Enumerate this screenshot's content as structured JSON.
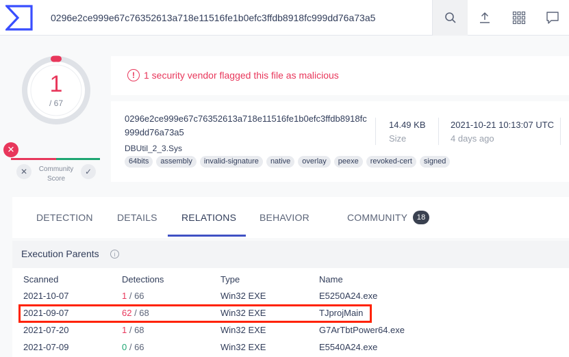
{
  "search": {
    "value": "0296e2ce999e67c76352613a718e11516fe1b0efc3ffdb8918fc999dd76a73a5"
  },
  "toolbar": {
    "icons": [
      "search-icon",
      "upload-icon",
      "apps-grid-icon",
      "chat-icon"
    ]
  },
  "score": {
    "detections": "1",
    "total": "/ 67",
    "community_label_line1": "Community",
    "community_label_line2": "Score"
  },
  "alert": {
    "text": "1 security vendor flagged this file as malicious",
    "icon": "!"
  },
  "file": {
    "hash_line1": "0296e2ce999e67c76352613a718e11516fe1b0efc3ffdb8918fc",
    "hash_line2": "999dd76a73a5",
    "name": "DBUtil_2_3.Sys",
    "tags": [
      "64bits",
      "assembly",
      "invalid-signature",
      "native",
      "overlay",
      "peexe",
      "revoked-cert",
      "signed"
    ],
    "size_value": "14.49 KB",
    "size_label": "Size",
    "date_value": "2021-10-21 10:13:07 UTC",
    "date_label": "4 days ago"
  },
  "tabs": [
    {
      "label": "DETECTION"
    },
    {
      "label": "DETAILS"
    },
    {
      "label": "RELATIONS",
      "active": true
    },
    {
      "label": "BEHAVIOR"
    },
    {
      "label": "COMMUNITY",
      "badge": "18"
    }
  ],
  "relations": {
    "section_title": "Execution Parents",
    "columns": [
      "Scanned",
      "Detections",
      "Type",
      "Name"
    ],
    "rows": [
      {
        "scanned": "2021-10-07",
        "det_pos": "1",
        "det_total": " / 66",
        "type": "Win32 EXE",
        "name": "E5250A24.exe",
        "color": "red"
      },
      {
        "scanned": "2021-09-07",
        "det_pos": "62",
        "det_total": " / 68",
        "type": "Win32 EXE",
        "name": "TJprojMain",
        "color": "red",
        "highlighted": true
      },
      {
        "scanned": "2021-07-20",
        "det_pos": "1",
        "det_total": " / 68",
        "type": "Win32 EXE",
        "name": "G7ArTbtPower64.exe",
        "color": "red"
      },
      {
        "scanned": "2021-07-09",
        "det_pos": "0",
        "det_total": " / 66",
        "type": "Win32 EXE",
        "name": "E5540A24.exe",
        "color": "green"
      }
    ]
  },
  "colors": {
    "malicious": "#e8375b",
    "clean": "#1ea672",
    "accent": "#3f51c4",
    "highlight_box": "#ff2200"
  }
}
